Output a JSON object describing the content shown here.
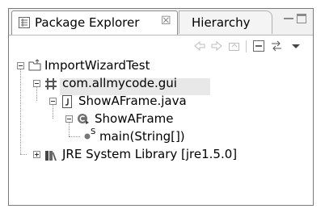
{
  "tabs": {
    "active_label": "Package Explorer",
    "close_glyph": "☒",
    "inactive_label": "Hierarchy"
  },
  "toolbar": {
    "icons": [
      "back-icon",
      "forward-icon",
      "up-icon",
      "collapse-all-icon",
      "link-with-editor-icon",
      "view-menu-icon"
    ]
  },
  "tree": {
    "project": "ImportWizardTest",
    "package": "com.allmycode.gui",
    "file": "ShowAFrame.java",
    "class": "ShowAFrame",
    "method": "main(String[])",
    "method_modifier": "S",
    "library": "JRE System Library [jre1.5.0]"
  },
  "colors": {
    "selection": "#e8e8e8",
    "border": "#7a7a7a"
  }
}
